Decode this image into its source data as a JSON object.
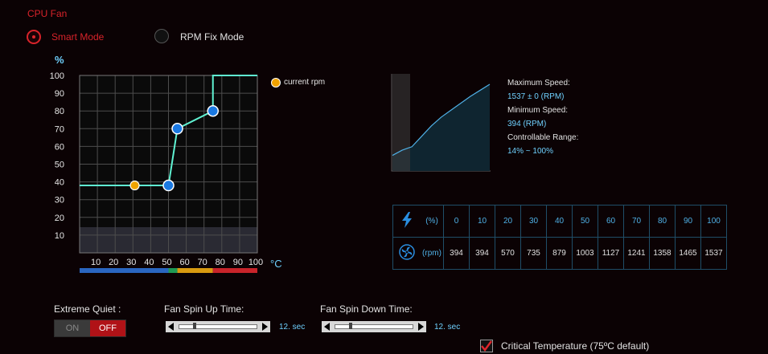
{
  "title": "CPU Fan",
  "modes": [
    {
      "label": "Smart Mode",
      "selected": true
    },
    {
      "label": "RPM Fix Mode",
      "selected": false
    }
  ],
  "curve_chart": {
    "y_unit": "%",
    "x_unit": "°C",
    "y_ticks": [
      "10",
      "20",
      "30",
      "40",
      "50",
      "60",
      "70",
      "80",
      "90",
      "100"
    ],
    "x_ticks": [
      "10",
      "20",
      "30",
      "40",
      "50",
      "60",
      "70",
      "80",
      "90",
      "100"
    ],
    "legend": "current rpm"
  },
  "chart_data": {
    "type": "line",
    "xlabel": "°C",
    "ylabel": "%",
    "xlim": [
      0,
      100
    ],
    "ylim": [
      0,
      100
    ],
    "points": [
      {
        "x": 0,
        "y": 38
      },
      {
        "x": 50,
        "y": 38
      },
      {
        "x": 55,
        "y": 70
      },
      {
        "x": 75,
        "y": 80
      },
      {
        "x": 75,
        "y": 100
      },
      {
        "x": 100,
        "y": 100
      }
    ],
    "control_points": [
      {
        "x": 50,
        "y": 38
      },
      {
        "x": 55,
        "y": 70
      },
      {
        "x": 75,
        "y": 80
      }
    ],
    "current_rpm_marker": {
      "x": 31,
      "y": 38
    },
    "temperature_bands": [
      {
        "from": 0,
        "to": 50,
        "color": "#2a66c0"
      },
      {
        "from": 50,
        "to": 55,
        "color": "#1f9a55"
      },
      {
        "from": 55,
        "to": 75,
        "color": "#d89a10"
      },
      {
        "from": 75,
        "to": 100,
        "color": "#c8242a"
      }
    ],
    "colors": {
      "line": "#5ff2d2",
      "control_point": "#1a79e2",
      "current": "#f0a300"
    }
  },
  "fan_info": {
    "max_label": "Maximum Speed:",
    "max_value": "1537 ± 0 (RPM)",
    "min_label": "Minimum Speed:",
    "min_value": "394 (RPM)",
    "range_label": "Controllable Range:",
    "range_value": "14% ~ 100%",
    "mini_curve": [
      0.18,
      0.24,
      0.28,
      0.4,
      0.52,
      0.62,
      0.7,
      0.78,
      0.86,
      0.93,
      1.0
    ]
  },
  "speed_table": {
    "pct_unit": "(%)",
    "rpm_unit": "(rpm)",
    "pct": [
      "0",
      "10",
      "20",
      "30",
      "40",
      "50",
      "60",
      "70",
      "80",
      "90",
      "100"
    ],
    "rpm": [
      "394",
      "394",
      "570",
      "735",
      "879",
      "1003",
      "1127",
      "1241",
      "1358",
      "1465",
      "1537"
    ]
  },
  "controls": {
    "extreme_quiet_label": "Extreme Quiet :",
    "toggle_on": "ON",
    "toggle_off": "OFF",
    "spin_up_label": "Fan Spin Up Time:",
    "spin_up_value": "12. sec",
    "spin_up_level": 0.2,
    "spin_down_label": "Fan Spin Down Time:",
    "spin_down_value": "12. sec",
    "spin_down_level": 0.2,
    "critical_label": "Critical Temperature (75ºC default)",
    "critical_checked": true
  }
}
